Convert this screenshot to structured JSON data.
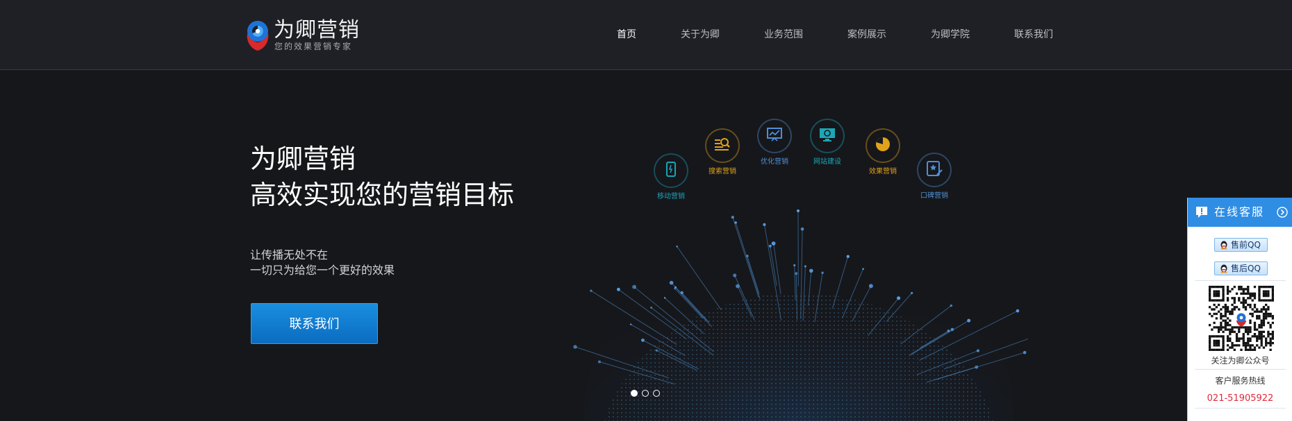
{
  "brand": {
    "name": "为卿营销",
    "slogan": "您的效果营销专家"
  },
  "nav": {
    "items": [
      {
        "label": "首页",
        "active": true
      },
      {
        "label": "关于为卿"
      },
      {
        "label": "业务范围"
      },
      {
        "label": "案例展示"
      },
      {
        "label": "为卿学院"
      },
      {
        "label": "联系我们"
      }
    ]
  },
  "hero": {
    "title_line1": "为卿营销",
    "title_line2": "高效实现您的营销目标",
    "subtitle_line1": "让传播无处不在",
    "subtitle_line2": "一切只为给您一个更好的效果",
    "cta_label": "联系我们"
  },
  "services": [
    {
      "label": "移动营销",
      "icon": "mobile-phone-icon",
      "color": "#1aa3b8"
    },
    {
      "label": "搜索营销",
      "icon": "search-list-icon",
      "color": "#e1a21b"
    },
    {
      "label": "优化营销",
      "icon": "chart-board-icon",
      "color": "#4f8fd6"
    },
    {
      "label": "网站建设",
      "icon": "monitor-icon",
      "color": "#19a8b8"
    },
    {
      "label": "效果营销",
      "icon": "pie-chart-icon",
      "color": "#e1a21b"
    },
    {
      "label": "口碑营销",
      "icon": "review-star-icon",
      "color": "#4f8fd6"
    }
  ],
  "carousel": {
    "count": 3,
    "active": 0
  },
  "sidebar": {
    "title": "在线客服",
    "qq_presale": "售前QQ",
    "qq_aftersale": "售后QQ",
    "follow_text": "关注为卿公众号",
    "hotline_label": "客户服务热线",
    "hotline_number": "021-51905922",
    "header_color": "#2f8de4"
  }
}
